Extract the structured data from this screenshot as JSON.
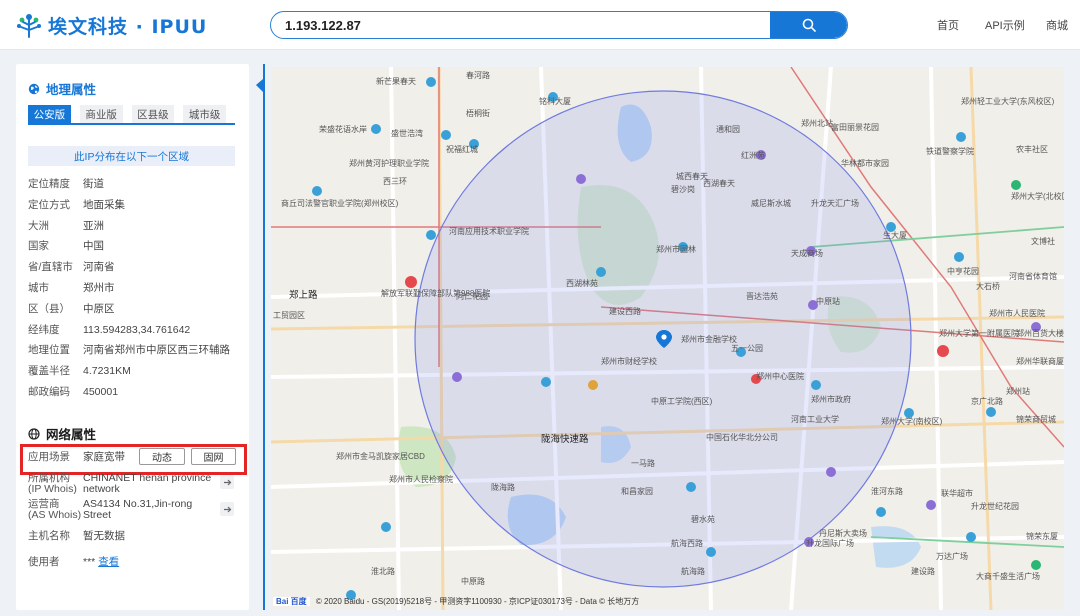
{
  "header": {
    "logo_text": "埃文科技 · IPUU",
    "search_value": "1.193.122.87",
    "nav": [
      "首页",
      "API示例",
      "商城"
    ],
    "accent": "#1677d6"
  },
  "geo": {
    "title": "地理属性",
    "tabs": [
      "公安版",
      "商业版",
      "区县级",
      "城市级"
    ],
    "active_tab": "公安版",
    "area_button": "此IP分布在以下一个区域",
    "rows": [
      {
        "k": "定位精度",
        "v": "街道"
      },
      {
        "k": "定位方式",
        "v": "地面采集"
      },
      {
        "k": "大洲",
        "v": "亚洲"
      },
      {
        "k": "国家",
        "v": "中国"
      },
      {
        "k": "省/直辖市",
        "v": "河南省"
      },
      {
        "k": "城市",
        "v": "郑州市"
      },
      {
        "k": "区（县）",
        "v": "中原区"
      },
      {
        "k": "经纬度",
        "v": "113.594283,34.761642"
      },
      {
        "k": "地理位置",
        "v": "河南省郑州市中原区西三环辅路"
      },
      {
        "k": "覆盖半径",
        "v": "4.7231KM"
      },
      {
        "k": "邮政编码",
        "v": "450001"
      }
    ]
  },
  "net": {
    "title": "网络属性",
    "scene_label": "应用场景",
    "scene_value": "家庭宽带",
    "chips": [
      "动态",
      "固网"
    ],
    "org_label_1": "所属机构",
    "org_label_2": "(IP Whois)",
    "org_value_1": "CHINANET henan province",
    "org_value_2": "network",
    "isp_label_1": "运营商",
    "isp_label_2": "(AS Whois)",
    "isp_value_1": "AS4134 No.31,Jin-rong",
    "isp_value_2": "Street",
    "host_label": "主机名称",
    "host_value": "暂无数据",
    "user_label": "使用者",
    "user_mask": "***",
    "user_link": "查看"
  },
  "map": {
    "footer": "© 2020 Baidu - GS(2019)5218号 - 甲测资字1100930 - 京ICP证030173号 - Data © 长地万方",
    "baidu_logo": "Bai 百度",
    "labels": [
      "新芒果春天",
      "春河路",
      "铭科大厦",
      "郑州北站",
      "郑州轻工业大学(东风校区)",
      "荣盛花语水岸",
      "盛世浩湾",
      "梧桐街",
      "通和园",
      "富田丽景花园",
      "祝福红城",
      "红洲苑",
      "华林都市家园",
      "铁道警察学院",
      "农丰社区",
      "郑州黄河护理职业学院",
      "西三环",
      "城西春天",
      "西湖春天",
      "郑州大学(北校区)",
      "商丘司法警官职业学院(郑州校区)",
      "碧沙岗",
      "威尼斯水城",
      "升龙天汇广场",
      "河南应用技术职业学院",
      "郑州市园林",
      "天成商场",
      "生大厦",
      "文博社",
      "中亨花园",
      "河南省体育馆",
      "郑上路",
      "解放军联勤保障部队第988医院",
      "同仁花园",
      "西湖林苑",
      "大石桥",
      "晋达浩苑",
      "中原站",
      "工贸园区",
      "建设西路",
      "郑州市金融学校",
      "郑州市人民医院",
      "五一公园",
      "郑州大学第一附属医院",
      "郑州市财经学校",
      "郑州百货大楼",
      "郑州华联商厦",
      "郑州中心医院",
      "郑州站",
      "郑州市政府",
      "中原工学院(西区)",
      "河南工业大学",
      "郑州大学(南校区)",
      "锦荣商贸城",
      "陇海快速路",
      "陇海路",
      "郑州市金马凯旋家居CBD",
      "郑州市人民检察院",
      "中国石化华北分公司",
      "淮河东路",
      "联华超市",
      "升龙世纪花园",
      "航海西路",
      "和昌家园",
      "碧水苑",
      "升龙国际广场",
      "航海路",
      "丹尼斯大卖场",
      "万达广场",
      "锦荣东厦",
      "大商千盛生活广场",
      "京广北路",
      "一马路",
      "淮北路",
      "中原路",
      "建设路"
    ]
  }
}
